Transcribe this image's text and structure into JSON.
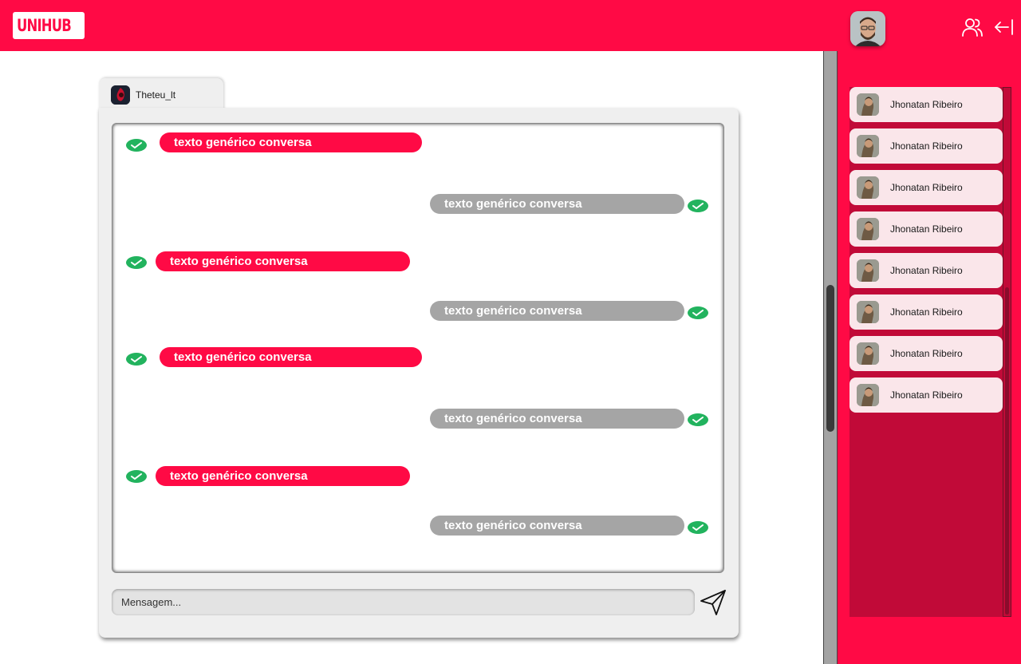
{
  "header": {
    "logo_text": "UNIHUB",
    "colors": {
      "primary": "#ff0a45",
      "dark_accent": "#c10a38",
      "sent_bubble": "#ff0a45",
      "received_bubble": "#a5a5a5",
      "check": "#22b35e"
    },
    "icons": [
      "user-avatar",
      "users-icon",
      "logout-arrow-icon"
    ]
  },
  "chat": {
    "contact_name": "Theteu_lt",
    "messages": [
      {
        "direction": "sent",
        "text": "texto genérico conversa",
        "status": "read"
      },
      {
        "direction": "received",
        "text": "texto genérico conversa",
        "status": "read"
      },
      {
        "direction": "sent",
        "text": "texto genérico conversa",
        "status": "read"
      },
      {
        "direction": "received",
        "text": "texto genérico conversa",
        "status": "read"
      },
      {
        "direction": "sent",
        "text": "texto genérico conversa",
        "status": "read"
      },
      {
        "direction": "received",
        "text": "texto genérico conversa",
        "status": "read"
      },
      {
        "direction": "sent",
        "text": "texto genérico conversa",
        "status": "read"
      },
      {
        "direction": "received",
        "text": "texto genérico conversa",
        "status": "read"
      }
    ],
    "input_placeholder": "Mensagem..."
  },
  "friends": {
    "items": [
      {
        "name": "Jhonatan Ribeiro"
      },
      {
        "name": "Jhonatan Ribeiro"
      },
      {
        "name": "Jhonatan Ribeiro"
      },
      {
        "name": "Jhonatan Ribeiro"
      },
      {
        "name": "Jhonatan Ribeiro"
      },
      {
        "name": "Jhonatan Ribeiro"
      },
      {
        "name": "Jhonatan Ribeiro"
      },
      {
        "name": "Jhonatan Ribeiro"
      }
    ]
  }
}
